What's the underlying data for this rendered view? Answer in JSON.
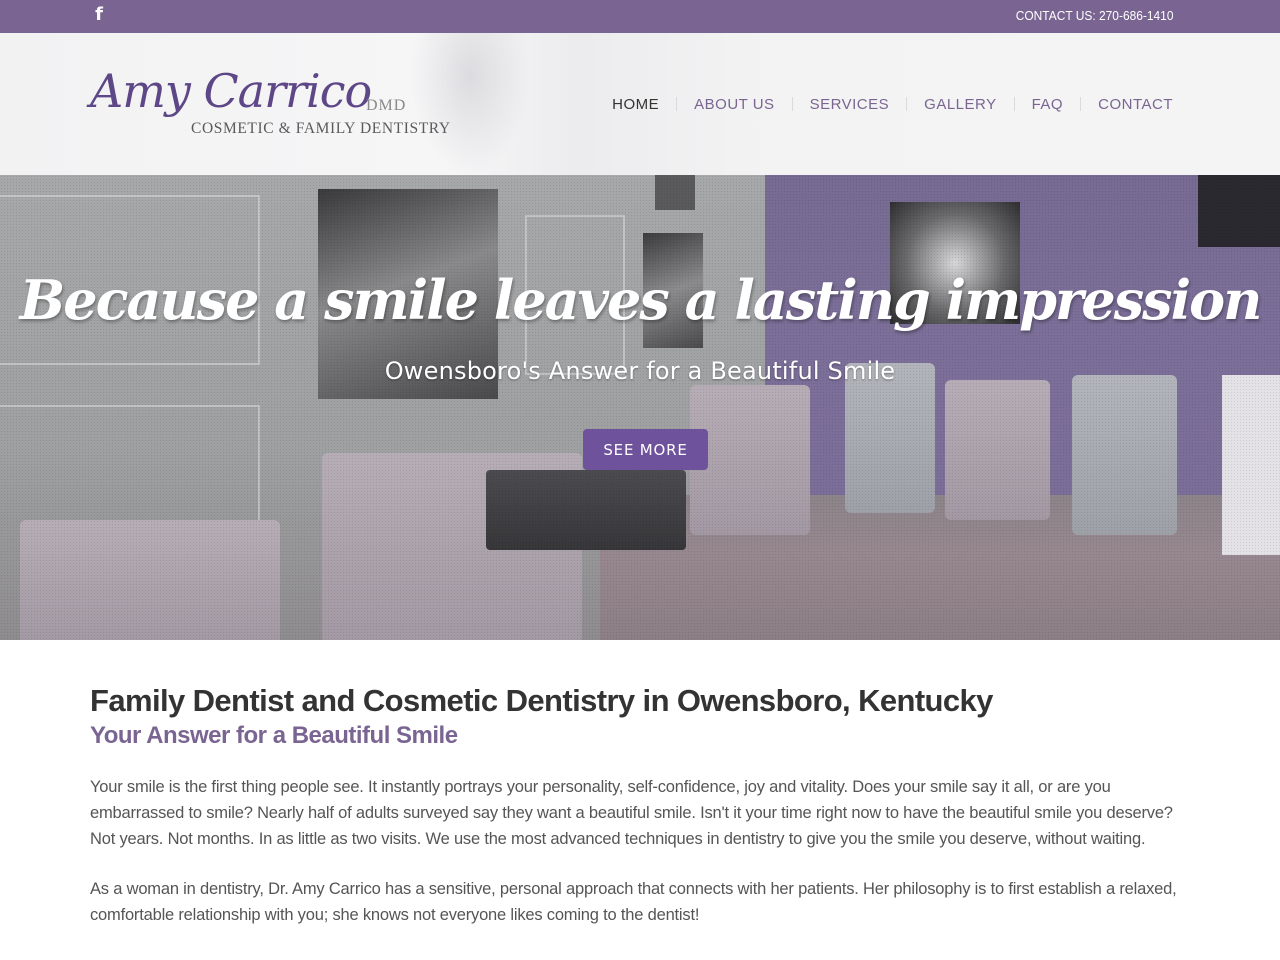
{
  "topbar": {
    "social_icon": "facebook-icon",
    "social_glyph": "f",
    "contact": "CONTACT US: 270-686-1410"
  },
  "logo": {
    "name": "Amy Carrico",
    "suffix": "DMD",
    "tagline": "COSMETIC & FAMILY DENTISTRY"
  },
  "nav": {
    "items": [
      {
        "label": "HOME",
        "active": true
      },
      {
        "label": "ABOUT US"
      },
      {
        "label": "SERVICES"
      },
      {
        "label": "GALLERY"
      },
      {
        "label": "FAQ"
      },
      {
        "label": "CONTACT"
      }
    ]
  },
  "hero": {
    "title": "Because a smile leaves a lasting impression",
    "subtitle": "Owensboro's Answer for a Beautiful Smile",
    "button": "SEE MORE"
  },
  "content": {
    "heading": "Family Dentist and Cosmetic Dentistry in Owensboro, Kentucky",
    "subheading": "Your Answer for a Beautiful Smile",
    "paragraphs": [
      "Your smile is the first thing people see. It instantly portrays your personality, self-confidence, joy and vitality. Does your smile say it all, or are you embarrassed to smile? Nearly half of adults surveyed say they want a beautiful smile. Isn't it your time right now to have the beautiful smile you deserve? Not years. Not months. In as little as two visits. We use the most advanced techniques in dentistry to give you the smile you deserve, without waiting.",
      "As a woman in dentistry, Dr. Amy Carrico has a sensitive, personal approach that connects with her patients. Her philosophy is to first establish a relaxed, comfortable relationship with you; she knows not everyone likes coming to the dentist!"
    ]
  },
  "colors": {
    "brand_purple": "#7a6592",
    "button_purple": "#6f529c",
    "logo_purple": "#5e4787",
    "text_dark": "#333333",
    "text_body": "#555555"
  }
}
